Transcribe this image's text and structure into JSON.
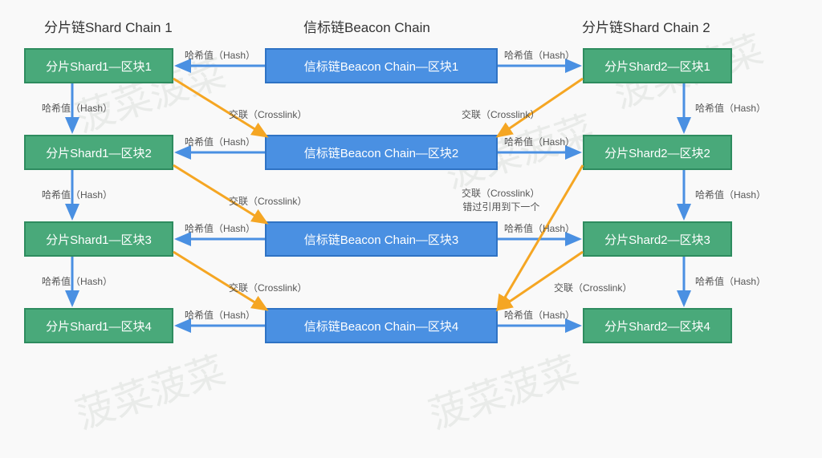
{
  "headers": {
    "shard1": "分片链Shard Chain 1",
    "beacon": "信标链Beacon Chain",
    "shard2": "分片链Shard Chain 2"
  },
  "shard1_blocks": [
    "分片Shard1—区块1",
    "分片Shard1—区块2",
    "分片Shard1—区块3",
    "分片Shard1—区块4"
  ],
  "beacon_blocks": [
    "信标链Beacon Chain—区块1",
    "信标链Beacon Chain—区块2",
    "信标链Beacon Chain—区块3",
    "信标链Beacon Chain—区块4"
  ],
  "shard2_blocks": [
    "分片Shard2—区块1",
    "分片Shard2—区块2",
    "分片Shard2—区块3",
    "分片Shard2—区块4"
  ],
  "labels": {
    "hash": "哈希值（Hash）",
    "crosslink": "交联（Crosslink）",
    "crosslink_miss": "交联（Crosslink）\n错过引用到下一个"
  },
  "watermark": "菠菜菠菜",
  "colors": {
    "shard": "#49a97a",
    "beacon": "#4a90e2",
    "arrow_blue": "#4a90e2",
    "arrow_orange": "#f5a623"
  }
}
